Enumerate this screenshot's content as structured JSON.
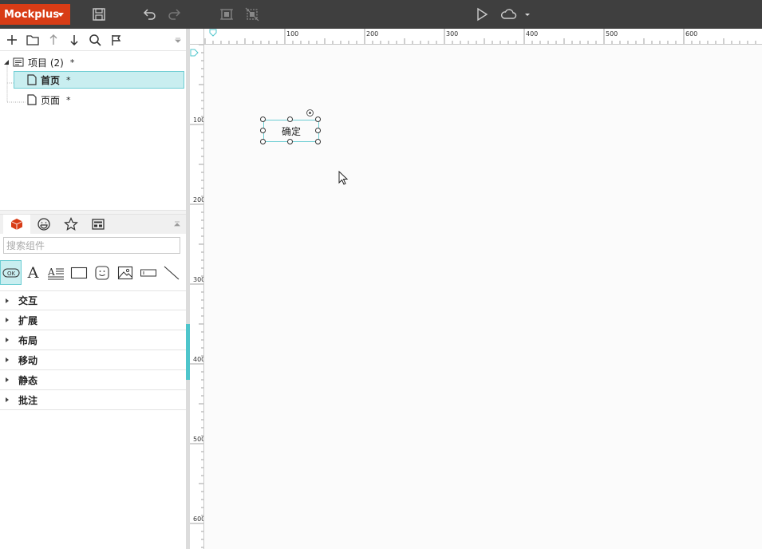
{
  "app": {
    "brand": "Mockplus"
  },
  "toolbar": {
    "icons": [
      "save-icon",
      "undo-icon",
      "redo-icon",
      "group-icon",
      "ungroup-icon",
      "play-icon",
      "cloud-icon",
      "dropdown-caret-icon"
    ]
  },
  "file_tools": [
    "add-icon",
    "folder-icon",
    "move-up-icon",
    "move-down-icon",
    "search-icon",
    "flag-icon"
  ],
  "tree": {
    "project": {
      "label": "项目 (2)",
      "star": "*"
    },
    "pages": [
      {
        "label": "首页",
        "star": "*",
        "selected": true
      },
      {
        "label": "页面",
        "star": "*",
        "selected": false
      }
    ]
  },
  "component_tabs": [
    "cube-icon",
    "emoji-icon",
    "star-icon",
    "template-icon"
  ],
  "search": {
    "placeholder": "搜索组件",
    "value": ""
  },
  "component_icons": [
    {
      "name": "button-component-icon",
      "text": "OK"
    },
    {
      "name": "text-component-icon",
      "text": "A"
    },
    {
      "name": "paragraph-component-icon",
      "text": "A"
    },
    {
      "name": "rectangle-component-icon"
    },
    {
      "name": "emoji-component-icon"
    },
    {
      "name": "image-component-icon"
    },
    {
      "name": "input-component-icon"
    },
    {
      "name": "line-component-icon"
    }
  ],
  "groups": [
    "交互",
    "扩展",
    "布局",
    "移动",
    "静态",
    "批注"
  ],
  "rulers": {
    "horizontal": [
      "100",
      "200",
      "300",
      "400",
      "500",
      "600"
    ],
    "vertical": [
      "100",
      "200",
      "300",
      "400",
      "500",
      "600"
    ]
  },
  "canvas": {
    "widget": {
      "label": "确定"
    }
  },
  "colors": {
    "brand": "#d83c16",
    "accent": "#4ec5cb",
    "selection": "#c9eef0",
    "toolbar": "#3f3f3f"
  }
}
